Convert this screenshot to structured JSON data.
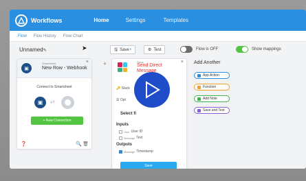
{
  "topnav": {
    "brand": "Workflows",
    "links": [
      "Home",
      "Settings",
      "Templates"
    ]
  },
  "subtabs": [
    "Flow",
    "Flow History",
    "Flow Chart"
  ],
  "toolbar": {
    "workflow_name": "Unnamed",
    "save_label": "Save",
    "test_label": "Test",
    "flow_status": "Flow is OFF",
    "mappings_label": "Show mappings"
  },
  "trigger_card": {
    "app_label": "Smartsheet",
    "title": "New Row - Webhook",
    "connect_text": "Connect to Smartsheet",
    "new_connection_label": "+ New Connection"
  },
  "action_card": {
    "app_label": "Slack",
    "title": "Send Direct Message",
    "field1": "Slack",
    "field2": "Opt",
    "select_label": "Select fi",
    "inputs_header": "Inputs",
    "inputs": [
      {
        "key": "User",
        "value": "User ID"
      },
      {
        "key": "Message",
        "value": "Text"
      }
    ],
    "outputs_header": "Outputs",
    "outputs": [
      {
        "key": "Message",
        "value": "Timestamp"
      }
    ],
    "save_label": "Save"
  },
  "add_another": {
    "title": "Add Another",
    "buttons": [
      {
        "label": "App Action",
        "color": "#2a8fe0"
      },
      {
        "label": "Function",
        "color": "#f0a020"
      },
      {
        "label": "Add Note",
        "color": "#3cb34a"
      },
      {
        "label": "Save and Test",
        "color": "#8a5fd3"
      }
    ]
  },
  "colors": {
    "primary": "#2a8fe0",
    "green": "#52c441",
    "play": "#1f4cc9"
  }
}
